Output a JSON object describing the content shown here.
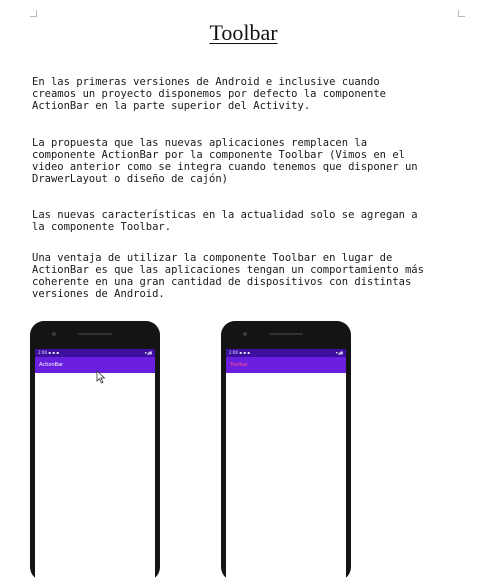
{
  "document": {
    "title": "Toolbar",
    "paragraphs": [
      "En las primeras versiones de Android e inclusive cuando\ncreamos un proyecto disponemos por defecto la componente\nActionBar en la parte superior del Activity.",
      "La propuesta que las nuevas aplicaciones remplacen la\ncomponente ActionBar por la componente Toolbar (Vimos en el\nvideo anterior como se integra cuando tenemos que disponer un\nDrawerLayout o diseño de cajón)",
      "Las nuevas características en la actualidad solo se agregan a\nla componente Toolbar.",
      "Una ventaja de utilizar la componente Toolbar en lugar de\nActionBar es que las aplicaciones tengan un comportamiento más\ncoherente en una gran cantidad de dispositivos con distintas\nversiones de Android."
    ]
  },
  "phones": [
    {
      "status_left": "2:00 ▪ ▪ ▪",
      "status_right": "▾◢▮",
      "bar_label": "ActionBar",
      "bar_color": "#6a1fe0",
      "status_color": "#3d0f9e"
    },
    {
      "status_left": "2:00 ▪ ▪ ▪",
      "status_right": "▾◢▮",
      "bar_label": "Toolbar",
      "bar_color": "#6a1fe0",
      "status_color": "#3d0f9e"
    }
  ],
  "icons": {
    "cursor": "mouse-pointer-icon"
  }
}
